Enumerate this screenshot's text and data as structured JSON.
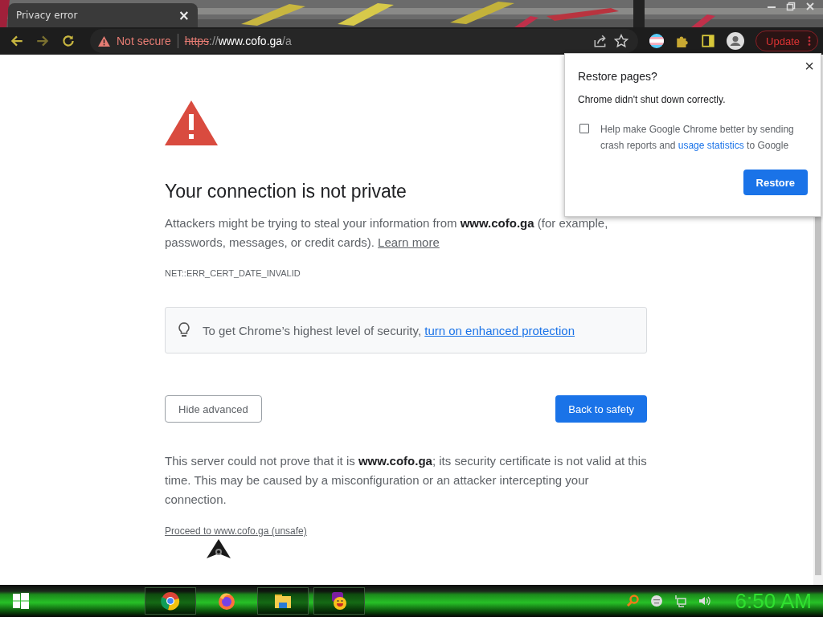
{
  "tab": {
    "title": "Privacy error",
    "close": "×"
  },
  "toolbar": {
    "security": "Not secure",
    "url": [
      {
        "text": "https",
        "kind": "scheme"
      },
      {
        "text": "://",
        "kind": "dim"
      },
      {
        "text": "www.cofo.ga",
        "kind": "host"
      },
      {
        "text": "/a",
        "kind": "dim"
      }
    ],
    "update": "Update"
  },
  "page": {
    "heading": "Your connection is not private",
    "intro": "Attackers might be trying to steal your information from **www.cofo.ga** (for example, passwords, messages, or credit cards).",
    "intro_link": "Learn more",
    "error_code": "NET::ERR_CERT_DATE_INVALID",
    "tip": "To get Chrome’s highest level of security,",
    "tip_link": "turn on enhanced protection",
    "buttons": [
      {
        "label": "Hide advanced",
        "kind": "secondary"
      },
      {
        "label": "Back to safety",
        "kind": "primary"
      }
    ],
    "details": "This server could not prove that it is **www.cofo.ga**; its security certificate is not valid at this time. This may be caused by a misconfiguration or an attacker intercepting your connection.",
    "proceed_link": "Proceed to www.cofo.ga (unsafe)"
  },
  "popup": {
    "title": "Restore pages?",
    "message": "Chrome didn't shut down correctly.",
    "checkbox": {
      "checked": false,
      "text": "Help make Google Chrome better by sending crash reports and",
      "link": "usage statistics",
      "text_after": "to Google"
    },
    "button": "Restore",
    "close": "×"
  },
  "taskbar": {
    "apps": [
      {
        "kind": "chrome",
        "running": true
      },
      {
        "kind": "firefox",
        "running": false
      },
      {
        "kind": "explorer",
        "running": true
      },
      {
        "kind": "yahoo",
        "running": true
      }
    ],
    "clock": "6:50 AM"
  }
}
